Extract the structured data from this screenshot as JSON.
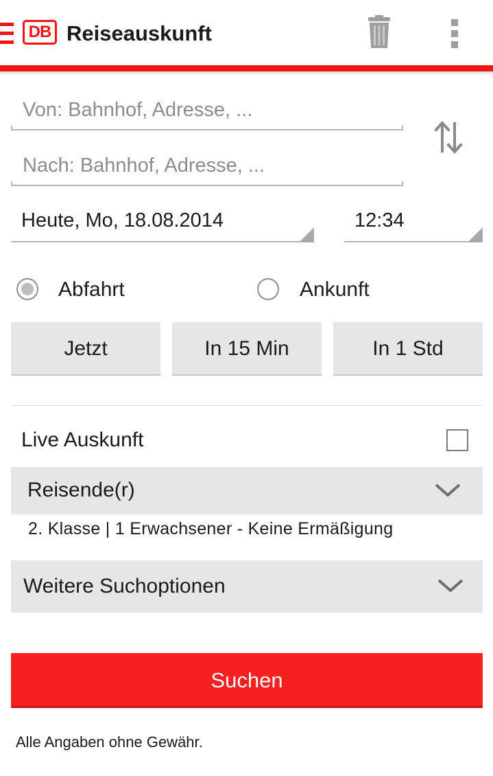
{
  "header": {
    "logo_text": "DB",
    "title": "Reiseauskunft",
    "brand_color": "#f01414",
    "icons": [
      "menu-icon",
      "trash-icon",
      "overflow-menu-icon"
    ]
  },
  "form": {
    "from": {
      "value": "",
      "placeholder": "Von: Bahnhof, Adresse, ..."
    },
    "to": {
      "value": "",
      "placeholder": "Nach: Bahnhof, Adresse, ..."
    },
    "date": "Heute, Mo, 18.08.2014",
    "time": "12:34",
    "departure_label": "Abfahrt",
    "arrival_label": "Ankunft",
    "selected_mode": "Abfahrt",
    "quick_buttons": [
      {
        "label": "Jetzt"
      },
      {
        "label": "In 15 Min"
      },
      {
        "label": "In 1 Std"
      }
    ],
    "live_label": "Live Auskunft",
    "live_checked": false,
    "travellers": {
      "label": "Reisende(r)",
      "summary": "2. Klasse  |  1 Erwachsener - Keine Ermäßigung"
    },
    "more_options_label": "Weitere Suchoptionen",
    "search_label": "Suchen",
    "search_color": "#f5201f",
    "disclaimer": "Alle Angaben ohne Gewähr."
  }
}
